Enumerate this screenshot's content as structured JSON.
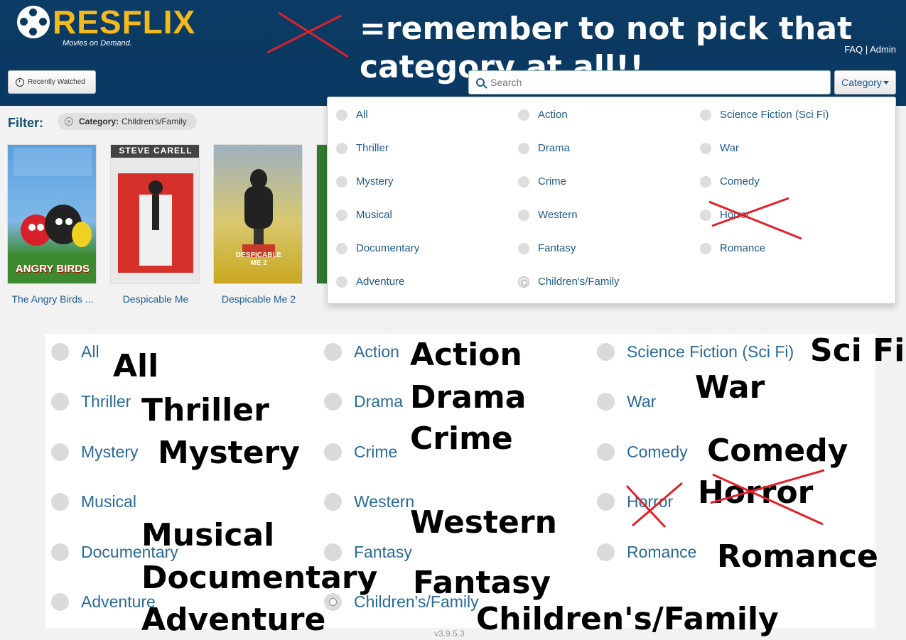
{
  "brand": {
    "name": "RESFLIX",
    "tagline": "Movies on Demand."
  },
  "header_links": {
    "faq": "FAQ",
    "sep": "|",
    "admin": "Admin"
  },
  "annotation_note": "=remember to not pick that category at all!!",
  "toolbar": {
    "recently_watched": "Recently Watched",
    "search_placeholder": "Search",
    "category_label": "Category"
  },
  "filter": {
    "label": "Filter:",
    "chip_key": "Category:",
    "chip_value": "Children's/Family"
  },
  "movies": [
    {
      "title": "The Angry Birds ...",
      "poster_text": "ANGRY BIRDS"
    },
    {
      "title": "Despicable Me",
      "poster_text": "STEVE CARELL"
    },
    {
      "title": "Despicable Me 2",
      "poster_text": "DESPICABLE ME 2"
    }
  ],
  "categories": {
    "col1": [
      "All",
      "Thriller",
      "Mystery",
      "Musical",
      "Documentary",
      "Adventure"
    ],
    "col2": [
      "Action",
      "Drama",
      "Crime",
      "Western",
      "Fantasy",
      "Children's/Family"
    ],
    "col3": [
      "Science Fiction (Sci Fi)",
      "War",
      "Comedy",
      "Horror",
      "Romance"
    ]
  },
  "selected_category": "Children's/Family",
  "zoom_annotations": {
    "col1": [
      "All",
      "Thriller",
      "Mystery",
      "Musical",
      "Documentary",
      "Adventure"
    ],
    "col2": [
      "Action",
      "Drama",
      "Crime",
      "Western",
      "Fantasy",
      "Children's/Family"
    ],
    "col3": [
      "Sci Fi",
      "War",
      "Comedy",
      "Horror",
      "Romance"
    ]
  },
  "version": "v3.9.5.3",
  "colors": {
    "header_bg": "#0a3860",
    "brand_accent": "#f5b81d",
    "link": "#1e5b8a",
    "annotation_red": "#e0202a"
  }
}
